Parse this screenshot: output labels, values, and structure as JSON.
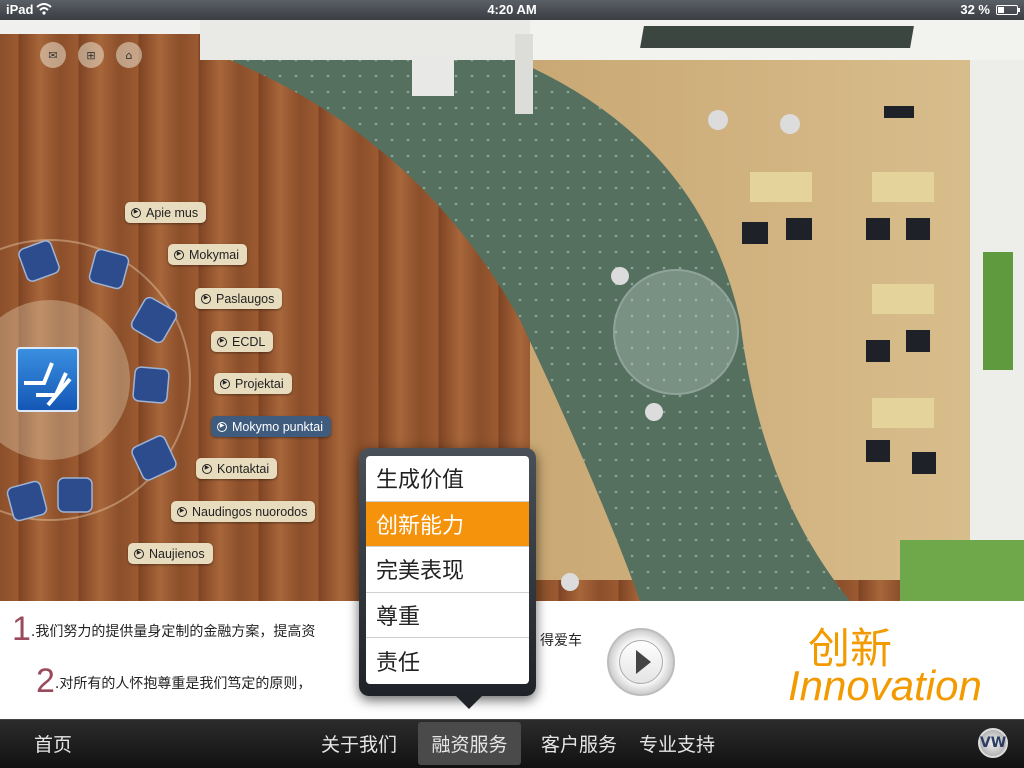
{
  "status_bar": {
    "device": "iPad",
    "time": "4:20 AM",
    "battery": "32 %",
    "battery_level": 0.32
  },
  "top_icons": [
    "mail-icon",
    "sitemap-icon",
    "home-icon"
  ],
  "side_menu": {
    "items": [
      {
        "label": "Apie mus"
      },
      {
        "label": "Mokymai"
      },
      {
        "label": "Paslaugos"
      },
      {
        "label": "ECDL"
      },
      {
        "label": "Projektai"
      },
      {
        "label": "Mokymo punktai",
        "active": true
      },
      {
        "label": "Kontaktai"
      },
      {
        "label": "Naudingos nuorodos"
      },
      {
        "label": "Naujienos"
      }
    ]
  },
  "banner": {
    "line1_num": "1",
    "line1_text": ".我们努力的提供量身定制的金融方案，提高资",
    "line1_tail": "得爱车",
    "line2_num": "2",
    "line2_text": ".对所有的人怀抱尊重是我们笃定的原则，",
    "title_cn": "创新",
    "title_en": "Innovation"
  },
  "popover": {
    "items": [
      "生成价值",
      "创新能力",
      "完美表现",
      "尊重",
      "责任"
    ],
    "selected_index": 1
  },
  "tab_bar": {
    "home": "首页",
    "about": "关于我们",
    "finance": "融资服务",
    "customer": "客户服务",
    "support": "专业支持",
    "brand_icon": "vw-logo-icon"
  },
  "colors": {
    "accent": "#f5930c",
    "active_pill": "#3f5c7e",
    "carpet": "#4f6b5a"
  }
}
